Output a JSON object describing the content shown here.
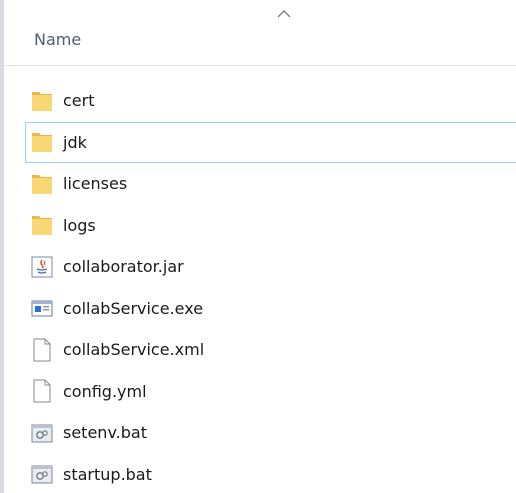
{
  "header": {
    "name_label": "Name",
    "sort_direction": "ascending"
  },
  "files": [
    {
      "name": "cert",
      "type": "folder",
      "icon": "folder-icon",
      "selected": false
    },
    {
      "name": "jdk",
      "type": "folder",
      "icon": "folder-icon",
      "selected": true
    },
    {
      "name": "licenses",
      "type": "folder",
      "icon": "folder-icon",
      "selected": false
    },
    {
      "name": "logs",
      "type": "folder",
      "icon": "folder-icon",
      "selected": false
    },
    {
      "name": "collaborator.jar",
      "type": "jar",
      "icon": "java-jar-icon",
      "selected": false
    },
    {
      "name": "collabService.exe",
      "type": "exe",
      "icon": "exe-window-icon",
      "selected": false
    },
    {
      "name": "collabService.xml",
      "type": "xml",
      "icon": "document-icon",
      "selected": false
    },
    {
      "name": "config.yml",
      "type": "yml",
      "icon": "document-icon",
      "selected": false
    },
    {
      "name": "setenv.bat",
      "type": "bat",
      "icon": "batch-gear-icon",
      "selected": false
    },
    {
      "name": "startup.bat",
      "type": "bat",
      "icon": "batch-gear-icon",
      "selected": false
    }
  ],
  "colors": {
    "folder": "#f8d775",
    "folder_dark": "#e8b94a",
    "selection_border": "#99d1ff",
    "header_text": "#4c607a"
  }
}
